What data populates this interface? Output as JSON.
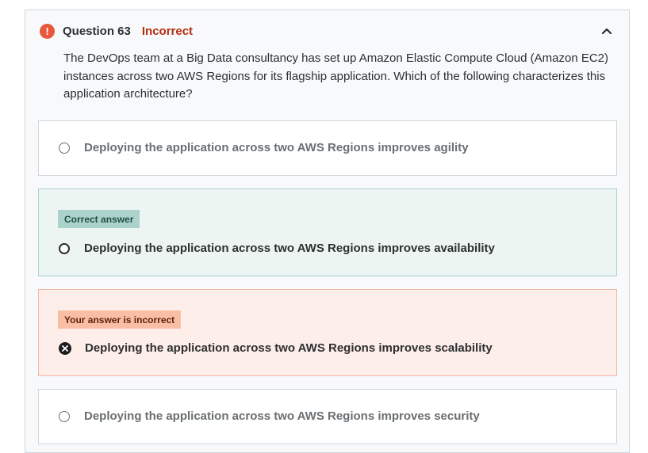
{
  "question": {
    "number_label": "Question 63",
    "status": "Incorrect",
    "text": "The DevOps team at a Big Data consultancy has set up Amazon Elastic Compute Cloud (Amazon EC2) instances across two AWS Regions for its flagship application. Which of the following characterizes this application architecture?"
  },
  "options": [
    {
      "label": "Deploying the application across two AWS Regions improves agility"
    },
    {
      "label": "Deploying the application across two AWS Regions improves availability",
      "badge": "Correct answer"
    },
    {
      "label": "Deploying the application across two AWS Regions improves scalability",
      "badge": "Your answer is incorrect"
    },
    {
      "label": "Deploying the application across two AWS Regions improves security"
    }
  ],
  "icons": {
    "alert": "alert-icon",
    "collapse": "chevron-up-icon",
    "wrong_choice": "x-circle-icon"
  },
  "colors": {
    "status_incorrect": "#b32d0f",
    "alert": "#e8573e",
    "correct_bg": "#edf5f3",
    "correct_badge": "#acd2cc",
    "wrong_bg": "#fdeee9",
    "wrong_badge": "#f8bfa4"
  }
}
